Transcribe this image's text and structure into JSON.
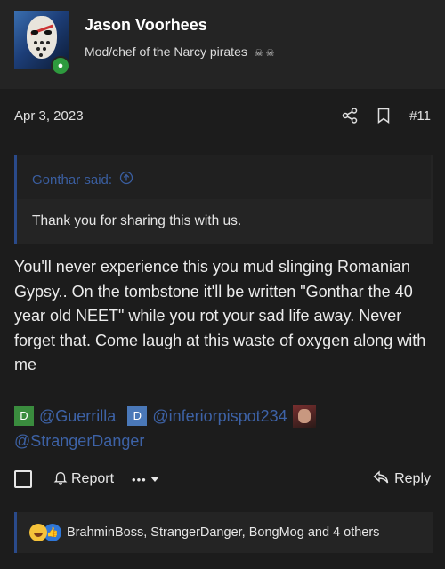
{
  "user": {
    "name": "Jason Voorhees",
    "title": "Mod/chef of the Narcy pirates",
    "title_emoji": "☠ ☠"
  },
  "post": {
    "date": "Apr 3, 2023",
    "number": "#11",
    "quote": {
      "author": "Gonthar said:",
      "text": "Thank you for sharing this with us."
    },
    "body": "You'll never experience this you mud slinging Romanian Gypsy.. On the tombstone it'll be written \"Gonthar the 40 year old NEET\" while you rot your sad life away. Never forget that. Come laugh at this waste of oxygen along with me",
    "mentions": [
      {
        "badge": "D",
        "badge_color": "#3a8c3e",
        "name": "@Guerrilla"
      },
      {
        "badge": "D",
        "badge_color": "#4a78b8",
        "name": "@inferiorpispot234"
      },
      {
        "name": "@StrangerDanger"
      }
    ]
  },
  "footer": {
    "report_label": "Report",
    "more_label": "•••",
    "reply_label": "Reply"
  },
  "reactions": {
    "text": "BrahminBoss, StrangerDanger, BongMog and 4 others"
  },
  "colors": {
    "background": "#1c1c1c",
    "link": "#3d62a6",
    "quote_bar": "#2a4a8a",
    "online": "#2e9a3e"
  }
}
